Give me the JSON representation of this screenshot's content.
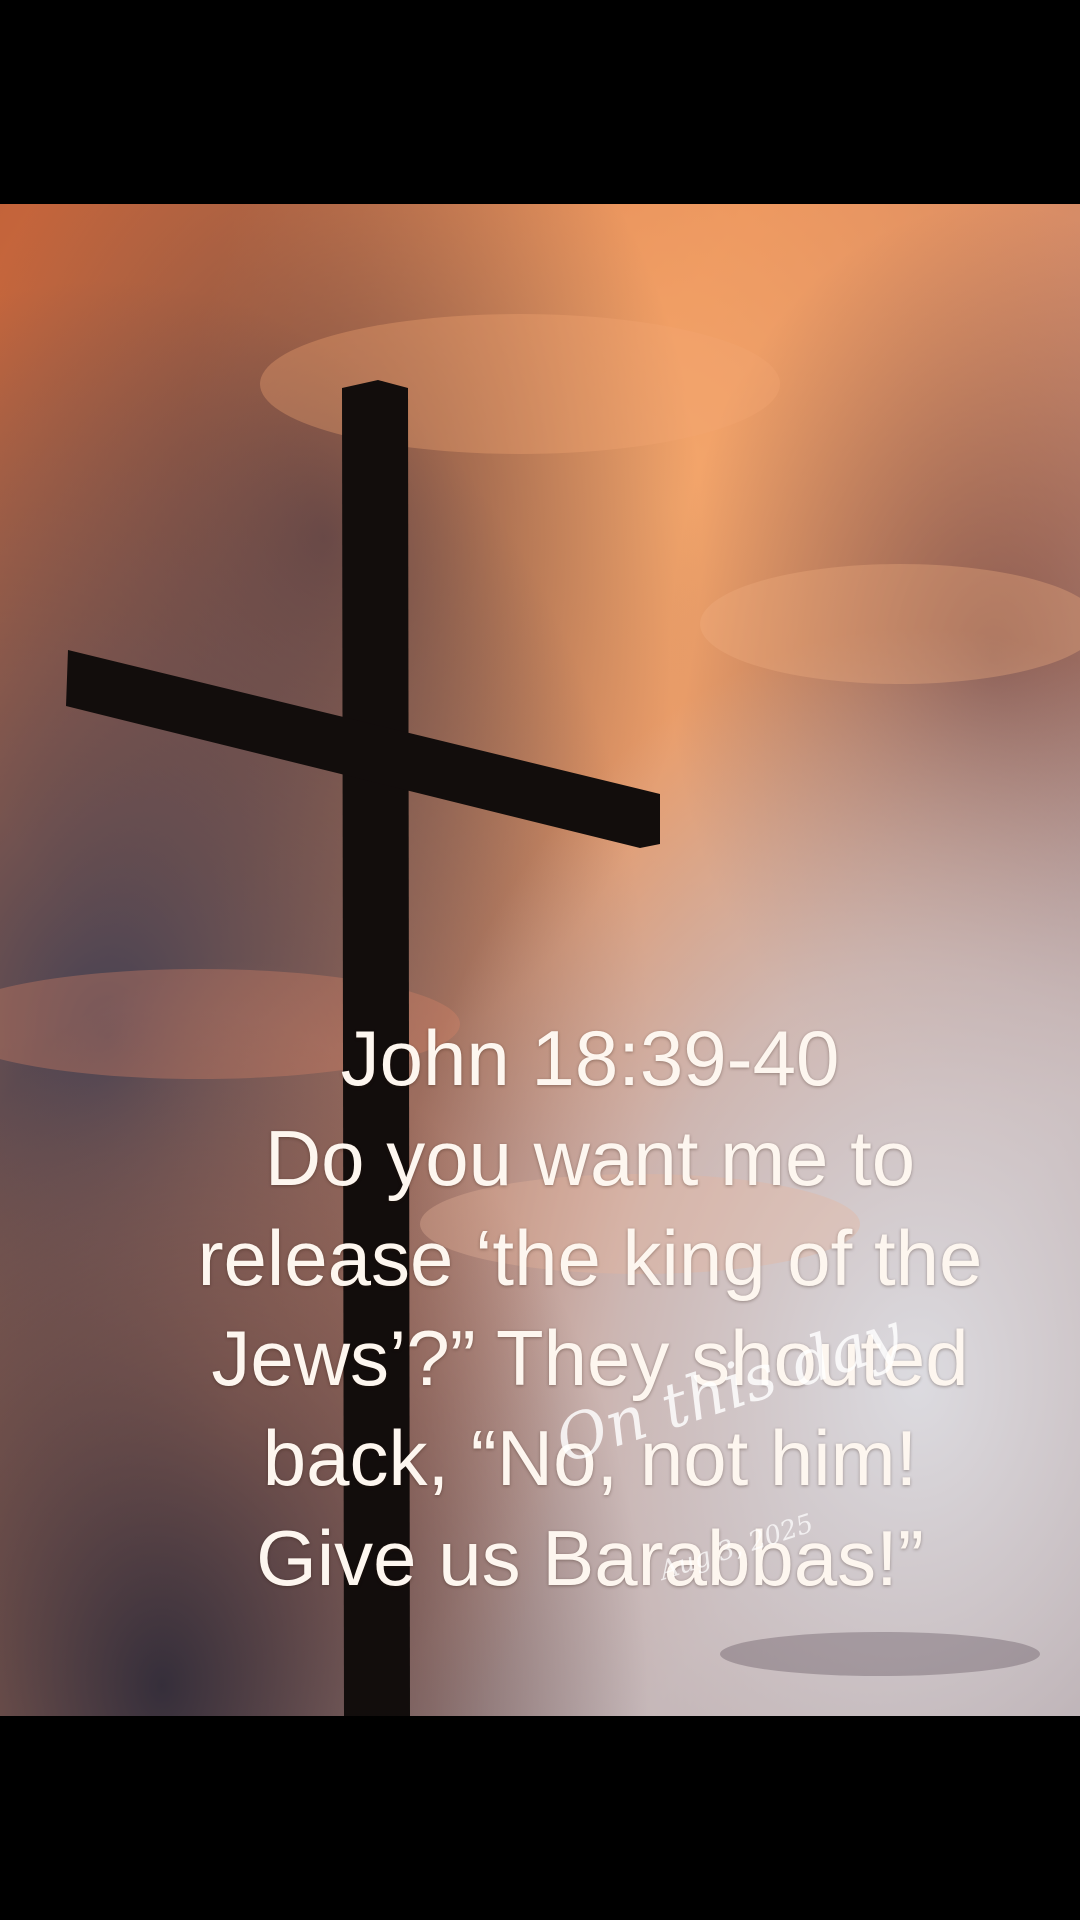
{
  "verse": {
    "lines": [
      "John 18:39-40",
      "Do you want me to",
      "release ‘the king of the",
      "Jews’?” They shouted",
      "back, “No, not him!",
      "Give us Barabbas!”"
    ]
  },
  "watermark": {
    "title": "On this day",
    "date": "Aug 3, 2025"
  },
  "colors": {
    "letterbox": "#000000",
    "sky_orange": "#e98b55",
    "sky_dark": "#3c3a4c",
    "sky_light": "#d9d4d2",
    "cross": "#120d0c",
    "text": "#fdf6ef"
  }
}
